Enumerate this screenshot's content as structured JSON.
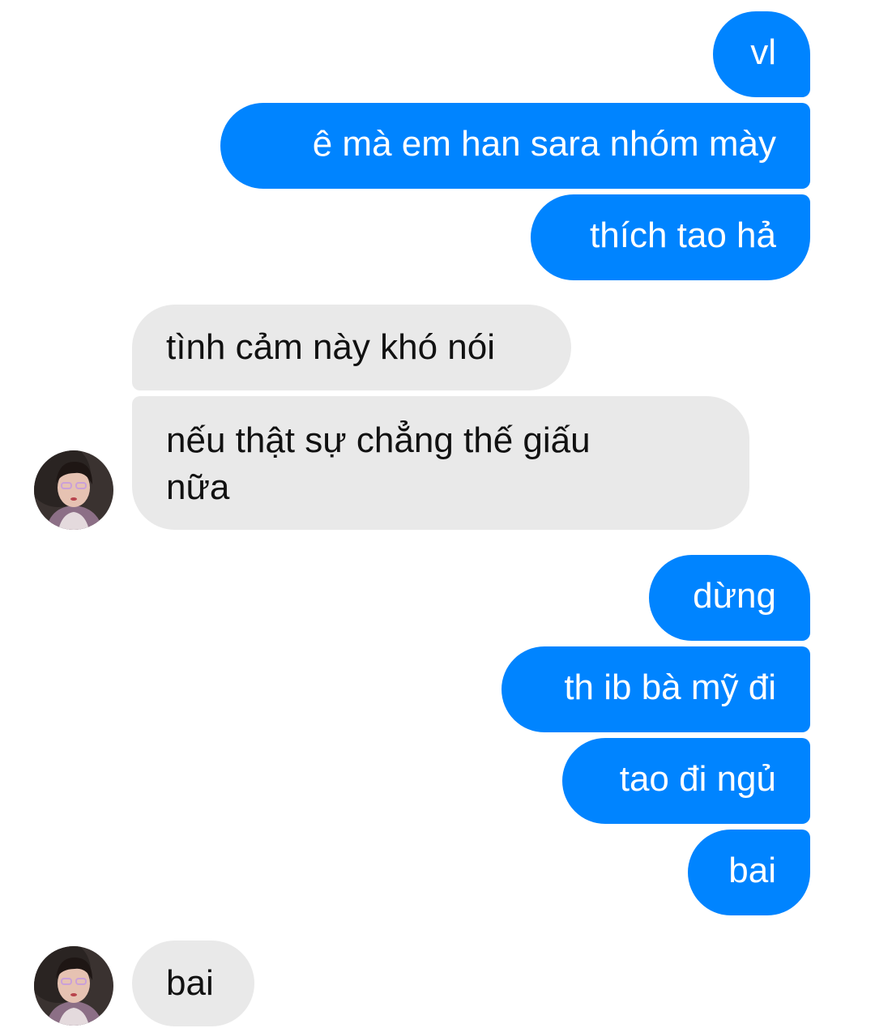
{
  "conversation": {
    "colors": {
      "outgoing_bubble": "#0084ff",
      "incoming_bubble": "#e9e9e9",
      "background": "#ffffff"
    },
    "messages": [
      {
        "sender": "me",
        "text": "vl"
      },
      {
        "sender": "me",
        "text": "ê mà em han sara nhóm mày"
      },
      {
        "sender": "me",
        "text": "thích tao hả"
      },
      {
        "sender": "them",
        "text": "tình cảm này khó nói"
      },
      {
        "sender": "them",
        "text": "nếu thật sự chẳng thế giấu nữa"
      },
      {
        "sender": "me",
        "text": "dừng"
      },
      {
        "sender": "me",
        "text": "th ib bà mỹ đi"
      },
      {
        "sender": "me",
        "text": "tao đi ngủ"
      },
      {
        "sender": "me",
        "text": "bai"
      },
      {
        "sender": "them",
        "text": "bai"
      }
    ],
    "avatar_icon": "contact-avatar-photo"
  }
}
